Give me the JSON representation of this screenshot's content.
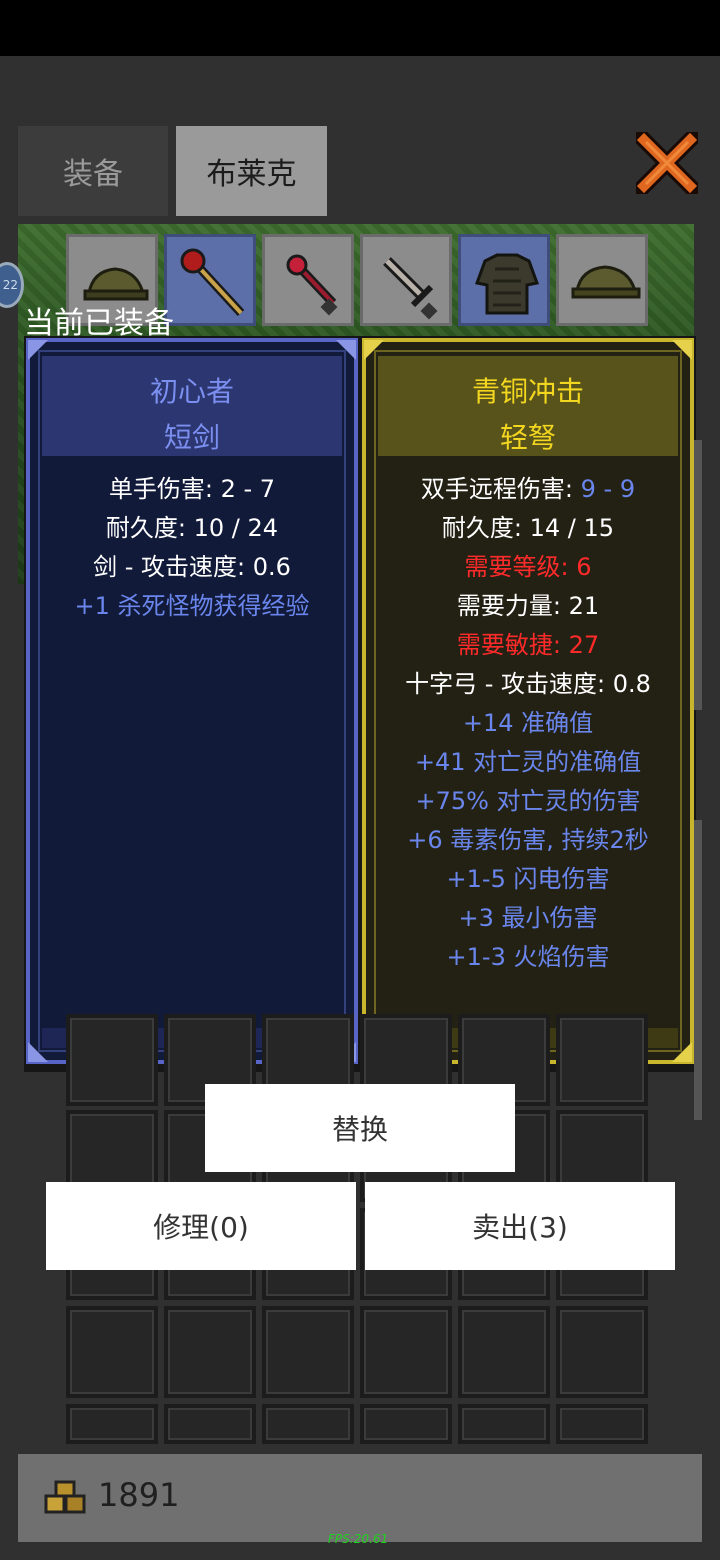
{
  "tabs": {
    "equip": "装备",
    "blake": "布莱克"
  },
  "current_equipped_label": "当前已装备",
  "level_badge": "22",
  "left_item": {
    "name_line1": "初心者",
    "name_line2": "短剑",
    "stats": [
      {
        "text": "单手伤害: 2 - 7",
        "color": "white"
      },
      {
        "text": "耐久度: 10 / 24",
        "color": "white"
      },
      {
        "text": "剑 - 攻击速度: 0.6",
        "color": "white"
      },
      {
        "text": "+1 杀死怪物获得经验",
        "color": "blue"
      }
    ]
  },
  "right_item": {
    "name_line1": "青铜冲击",
    "name_line2": "轻弩",
    "damage_label": "双手远程伤害: ",
    "damage_value": "9 - 9",
    "stats": [
      {
        "text": "耐久度: 14 / 15",
        "color": "white"
      },
      {
        "text": "需要等级: 6",
        "color": "red"
      },
      {
        "text": "需要力量: 21",
        "color": "white"
      },
      {
        "text": "需要敏捷: 27",
        "color": "red"
      },
      {
        "text": "十字弓 - 攻击速度: 0.8",
        "color": "white"
      },
      {
        "text": "+14 准确值",
        "color": "blue"
      },
      {
        "text": "+41 对亡灵的准确值",
        "color": "blue"
      },
      {
        "text": "+75% 对亡灵的伤害",
        "color": "blue"
      },
      {
        "text": "+6 毒素伤害, 持续2秒",
        "color": "blue"
      },
      {
        "text": "+1-5 闪电伤害",
        "color": "blue"
      },
      {
        "text": "+3 最小伤害",
        "color": "blue"
      },
      {
        "text": "+1-3 火焰伤害",
        "color": "blue"
      }
    ]
  },
  "buttons": {
    "replace": "替换",
    "repair": "修理(0)",
    "sell": "卖出(3)"
  },
  "gold": "1891",
  "fps": "FPS:20.61",
  "colors": {
    "left_border": "#5964c7",
    "right_border": "#c8b72d",
    "stat_blue": "#6a86ec",
    "stat_red": "#ff2a2a"
  },
  "icons": [
    "close-x-icon",
    "helmet-icon",
    "staff-icon",
    "scepter-icon",
    "sword-icon",
    "armor-icon",
    "hat-icon",
    "gold-coins-icon"
  ]
}
